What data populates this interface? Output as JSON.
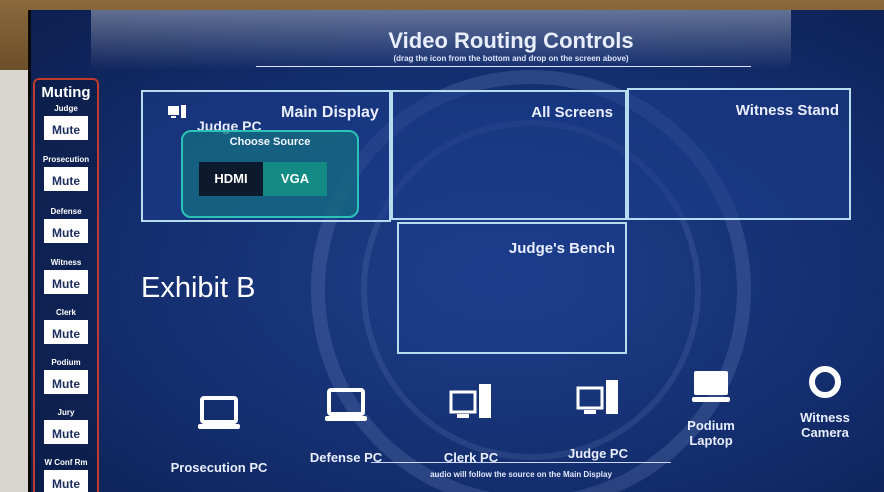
{
  "header": {
    "title": "Video Routing Controls",
    "subtitle": "(drag the icon from the bottom and drop on the screen above)"
  },
  "muting": {
    "title": "Muting",
    "groups": [
      {
        "label": "Judge",
        "button": "Mute"
      },
      {
        "label": "Prosecution",
        "button": "Mute"
      },
      {
        "label": "Defense",
        "button": "Mute"
      },
      {
        "label": "Witness",
        "button": "Mute"
      },
      {
        "label": "Clerk",
        "button": "Mute"
      },
      {
        "label": "Podium",
        "button": "Mute"
      },
      {
        "label": "Jury",
        "button": "Mute"
      },
      {
        "label": "W Conf Rm",
        "button": "Mute"
      }
    ]
  },
  "zones": {
    "main": {
      "label": "Main Display",
      "assigned_source": "Judge PC",
      "chooser_title": "Choose Source",
      "options": [
        "HDMI",
        "VGA"
      ],
      "selected": "HDMI"
    },
    "all": {
      "label": "All Screens"
    },
    "witness": {
      "label": "Witness Stand"
    },
    "bench": {
      "label": "Judge's Bench"
    }
  },
  "overlay_text": "Exhibit B",
  "sources": [
    {
      "label": "Prosecution PC",
      "icon": "laptop-icon"
    },
    {
      "label": "Defense PC",
      "icon": "laptop-icon"
    },
    {
      "label": "Clerk PC",
      "icon": "desktop-pc-icon"
    },
    {
      "label": "Judge PC",
      "icon": "desktop-pc-icon"
    },
    {
      "label": "Podium Laptop",
      "icon": "laptop-icon"
    },
    {
      "label": "Witness Camera",
      "icon": "camera-icon"
    }
  ],
  "footer": {
    "note": "audio will follow the source on the Main Display"
  },
  "colors": {
    "screen_bg": "#142e6e",
    "zone_border": "#b7dcf0",
    "chooser_border": "#2bc3b8",
    "muting_border": "#c0392b"
  }
}
